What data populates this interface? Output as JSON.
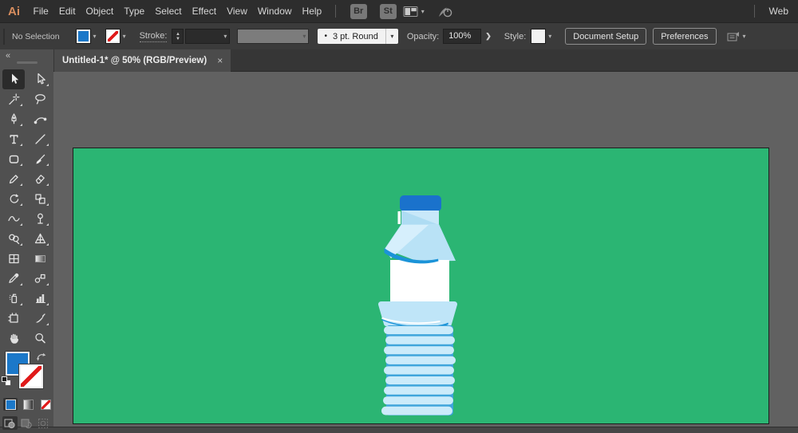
{
  "menu": {
    "logo": "Ai",
    "items": [
      "File",
      "Edit",
      "Object",
      "Type",
      "Select",
      "Effect",
      "View",
      "Window",
      "Help"
    ],
    "chips": [
      "Br",
      "St"
    ],
    "workspace": "Web"
  },
  "control": {
    "selection_status": "No Selection",
    "stroke_label": "Stroke:",
    "brush_bullet": "•",
    "brush_value": "3 pt. Round",
    "opacity_label": "Opacity:",
    "opacity_value": "100%",
    "style_label": "Style:",
    "doc_setup_label": "Document Setup",
    "preferences_label": "Preferences"
  },
  "tab": {
    "title": "Untitled-1* @ 50% (RGB/Preview)",
    "close": "×"
  },
  "toolbar": {
    "collapse": "«",
    "tools": [
      "selection",
      "direct-selection",
      "magic-wand",
      "lasso",
      "pen",
      "curvature",
      "type",
      "line-segment",
      "rectangle",
      "paintbrush",
      "pencil",
      "eraser",
      "rotate",
      "scale",
      "width",
      "free-transform",
      "shape-builder",
      "perspective-grid",
      "mesh",
      "gradient",
      "eyedropper",
      "blend",
      "symbol-sprayer",
      "column-graph",
      "artboard",
      "slice",
      "hand",
      "zoom"
    ],
    "active_tool": "selection",
    "appearance_buttons": [
      "fill-color",
      "gradient",
      "none"
    ],
    "drawing_modes": [
      "draw-normal",
      "draw-behind",
      "draw-inside"
    ]
  },
  "colors": {
    "menubar_bg": "#2d2d2d",
    "controlbar_bg": "#3b3b3b",
    "toolbar_bg": "#505050",
    "tabbar_bg": "#363636",
    "tab_bg": "#4b4b4b",
    "canvas_bg": "#616161",
    "artboard_green": "#2bb573",
    "fill_blue": "#1b78c9",
    "red_slash": "#e01b1b",
    "logo_orange": "#d78d5e",
    "cap_blue": "#1a72cc",
    "bottle_main": "#b9e2f6",
    "bottle_light": "#d6effc",
    "bottle_pale": "#c8e8f9",
    "bottle_trap": "#bfe5f8",
    "bottle_rib": "#cbebfa",
    "bottle_rib_shadow": "#3fa5db",
    "bottle_accent": "#1b93d8",
    "label_white": "#ffffff"
  }
}
